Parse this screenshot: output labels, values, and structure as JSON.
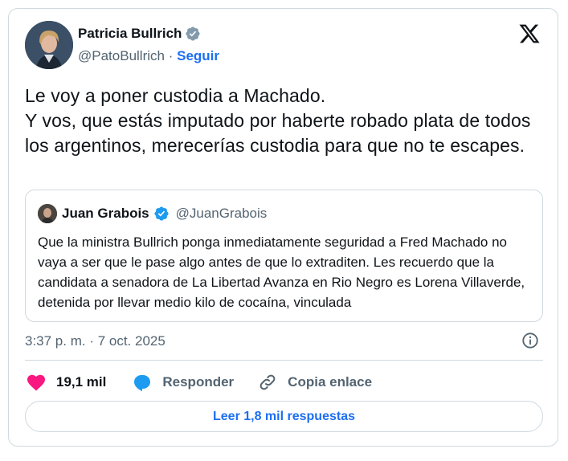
{
  "author": {
    "name": "Patricia Bullrich",
    "handle": "@PatoBullrich",
    "separator": "·",
    "follow_label": "Seguir"
  },
  "icons": {
    "verified": "verified-badge-icon",
    "logo": "x-logo-icon",
    "info": "info-icon",
    "like": "heart-icon",
    "reply": "speech-bubble-icon",
    "link": "link-icon"
  },
  "colors": {
    "accent": "#1d6ff2",
    "verified_gray": "#829aab",
    "verified_blue": "#1d9bf0",
    "like": "#f91880"
  },
  "tweet": {
    "text": "Le voy a poner custodia a Machado.\nY vos, que estás imputado por haberte robado plata de todos los argentinos, merecerías custodia para que no te escapes."
  },
  "quote": {
    "name": "Juan Grabois",
    "handle": "@JuanGrabois",
    "text": "Que la ministra Bullrich ponga inmediatamente seguridad a Fred Machado no vaya a ser que le pase algo antes de que lo extraditen. Les recuerdo que la candidata a senadora de La Libertad Avanza en Rio Negro es Lorena Villaverde, detenida por llevar medio kilo de cocaína, vinculada"
  },
  "meta": {
    "timestamp": "3:37 p. m. · 7 oct. 2025"
  },
  "actions": {
    "likes": "19,1 mil",
    "reply_label": "Responder",
    "copy_link_label": "Copia enlace"
  },
  "replies_button": "Leer 1,8 mil respuestas"
}
